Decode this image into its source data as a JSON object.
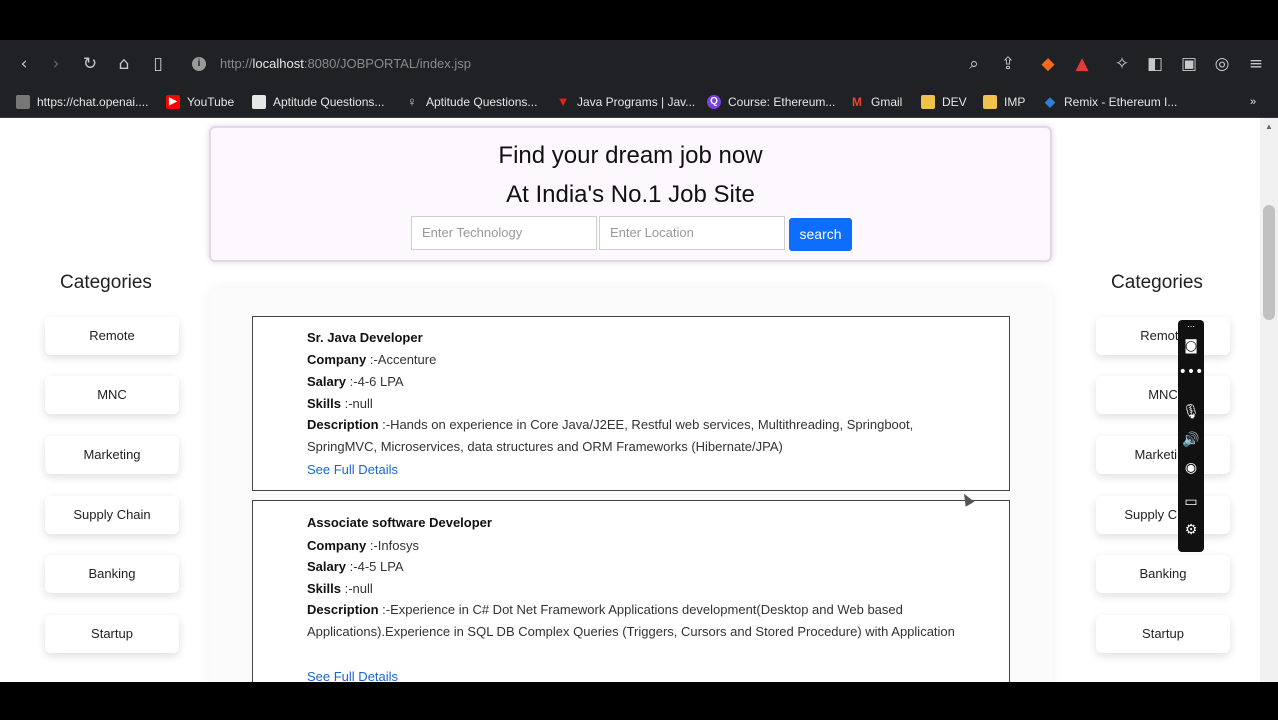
{
  "browser": {
    "url_prefix": "http://",
    "url_host": "localhost",
    "url_path": ":8080/JOBPORTAL/index.jsp",
    "bookmarks": [
      {
        "label": "https://chat.openai....",
        "icon": "page-icon",
        "color": "#777777"
      },
      {
        "label": "YouTube",
        "icon": "youtube-icon",
        "color": "#ff0000"
      },
      {
        "label": "Aptitude Questions...",
        "icon": "page-icon",
        "color": "#e6e6e6"
      },
      {
        "label": "Aptitude Questions...",
        "icon": "bulb-icon",
        "color": "#cccccc"
      },
      {
        "label": "Java Programs | Jav...",
        "icon": "java-icon",
        "color": "#e0201b"
      },
      {
        "label": "Course: Ethereum...",
        "icon": "course-icon",
        "color": "#7b3fe4"
      },
      {
        "label": "Gmail",
        "icon": "gmail-icon",
        "color": "#ea4335"
      },
      {
        "label": "DEV",
        "icon": "folder-icon",
        "color": "#f0c24b"
      },
      {
        "label": "IMP",
        "icon": "folder-icon",
        "color": "#f0c24b"
      },
      {
        "label": "Remix - Ethereum I...",
        "icon": "remix-icon",
        "color": "#2f7fd8"
      }
    ]
  },
  "hero": {
    "title1": "Find your dream job now",
    "title2": "At India's No.1 Job Site",
    "tech_placeholder": "Enter Technology",
    "location_placeholder": "Enter Location",
    "search_label": "search"
  },
  "categories": {
    "title": "Categories",
    "left": [
      "Remote",
      "MNC",
      "Marketing",
      "Supply Chain",
      "Banking",
      "Startup"
    ],
    "right": [
      "Remote",
      "MNC",
      "Marketing",
      "Supply Chain",
      "Banking",
      "Startup"
    ]
  },
  "jobs": [
    {
      "title": "Sr. Java Developer",
      "company_label": "Company",
      "company": " :-Accenture",
      "salary_label": "Salary",
      "salary": " :-4-6 LPA",
      "skills_label": "Skills",
      "skills": " :-null",
      "description_label": "Description",
      "description": " :-Hands on experience in Core Java/J2EE, Restful web services, Multithreading, Springboot, SpringMVC, Microservices, data structures and ORM Frameworks (Hibernate/JPA)",
      "link": "See Full Details"
    },
    {
      "title": "Associate software Developer",
      "company_label": "Company",
      "company": " :-Infosys",
      "salary_label": "Salary",
      "salary": " :-4-5 LPA",
      "skills_label": "Skills",
      "skills": " :-null",
      "description_label": "Description",
      "description": " :-Experience in C# Dot Net Framework Applications development(Desktop and Web based Applications).Experience in SQL DB Complex Queries (Triggers, Cursors and Stored Procedure) with Application",
      "link": "See Full Details"
    }
  ],
  "colors": {
    "accent": "#0d6efd",
    "link": "#1a66d6"
  }
}
